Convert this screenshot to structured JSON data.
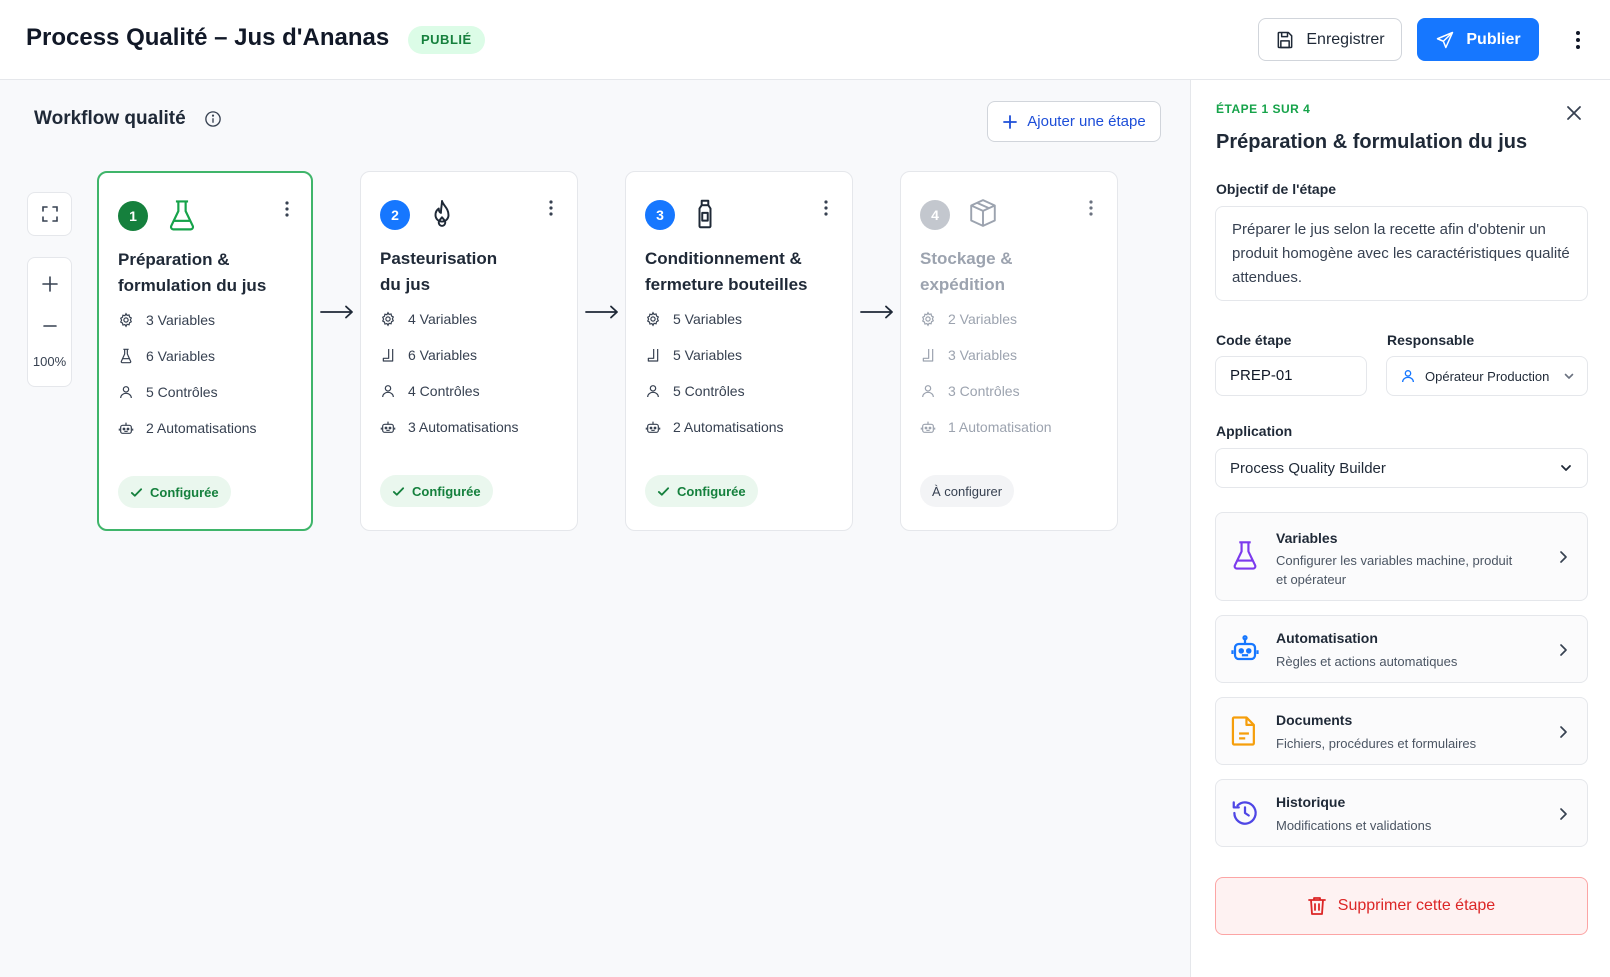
{
  "header": {
    "title": "Process Qualité – Jus d'Ananas",
    "status_badge": "PUBLIÉ",
    "save_label": "Enregistrer",
    "publish_label": "Publier"
  },
  "canvas": {
    "title": "Workflow qualité",
    "add_step_label": "Ajouter une étape",
    "zoom_level": "100%"
  },
  "steps": [
    {
      "number": "1",
      "name_line1": "Préparation &",
      "name_line2": "formulation du jus",
      "icon": "flask-icon",
      "stat1": "3 Variables",
      "stat2": "6 Variables",
      "stat3": "5 Contrôles",
      "stat4": "2 Automatisations",
      "status": "Configurée"
    },
    {
      "number": "2",
      "name_line1": "Pasteurisation",
      "name_line2": "du jus",
      "icon": "flame-icon",
      "stat1": "4 Variables",
      "stat2": "6 Variables",
      "stat3": "4 Contrôles",
      "stat4": "3 Automatisations",
      "status": "Configurée"
    },
    {
      "number": "3",
      "name_line1": "Conditionnement &",
      "name_line2": "fermeture bouteilles",
      "icon": "bottle-icon",
      "stat1": "5 Variables",
      "stat2": "5 Variables",
      "stat3": "5 Contrôles",
      "stat4": "2 Automatisations",
      "status": "Configurée"
    },
    {
      "number": "4",
      "name_line1": "Stockage &",
      "name_line2": "expédition",
      "icon": "box-icon",
      "stat1": "2 Variables",
      "stat2": "3 Variables",
      "stat3": "3 Contrôles",
      "stat4": "1 Automatisation",
      "status": "À configurer"
    }
  ],
  "panel": {
    "step_indicator": "ÉTAPE 1 SUR 4",
    "title": "Préparation & formulation du jus",
    "objective_label": "Objectif de l'étape",
    "objective_text": "Préparer le jus selon la recette afin d'obtenir un produit homogène avec les caractéristiques qualité attendues.",
    "code_label": "Code étape",
    "code_value": "PREP-01",
    "responsible_label": "Responsable",
    "responsible_value": "Opérateur Production",
    "application_label": "Application",
    "application_value": "Process Quality Builder",
    "sections": [
      {
        "title": "Variables",
        "desc": "Configurer les variables machine, produit et opérateur"
      },
      {
        "title": "Automatisation",
        "desc": "Règles et actions automatiques"
      },
      {
        "title": "Documents",
        "desc": "Fichiers, procédures et formulaires"
      },
      {
        "title": "Historique",
        "desc": "Modifications et validations"
      }
    ],
    "delete_label": "Supprimer cette étape"
  },
  "colors": {
    "primary": "#1677ff",
    "success": "#16a34a",
    "danger": "#dc2626",
    "muted": "#9ca3af"
  }
}
